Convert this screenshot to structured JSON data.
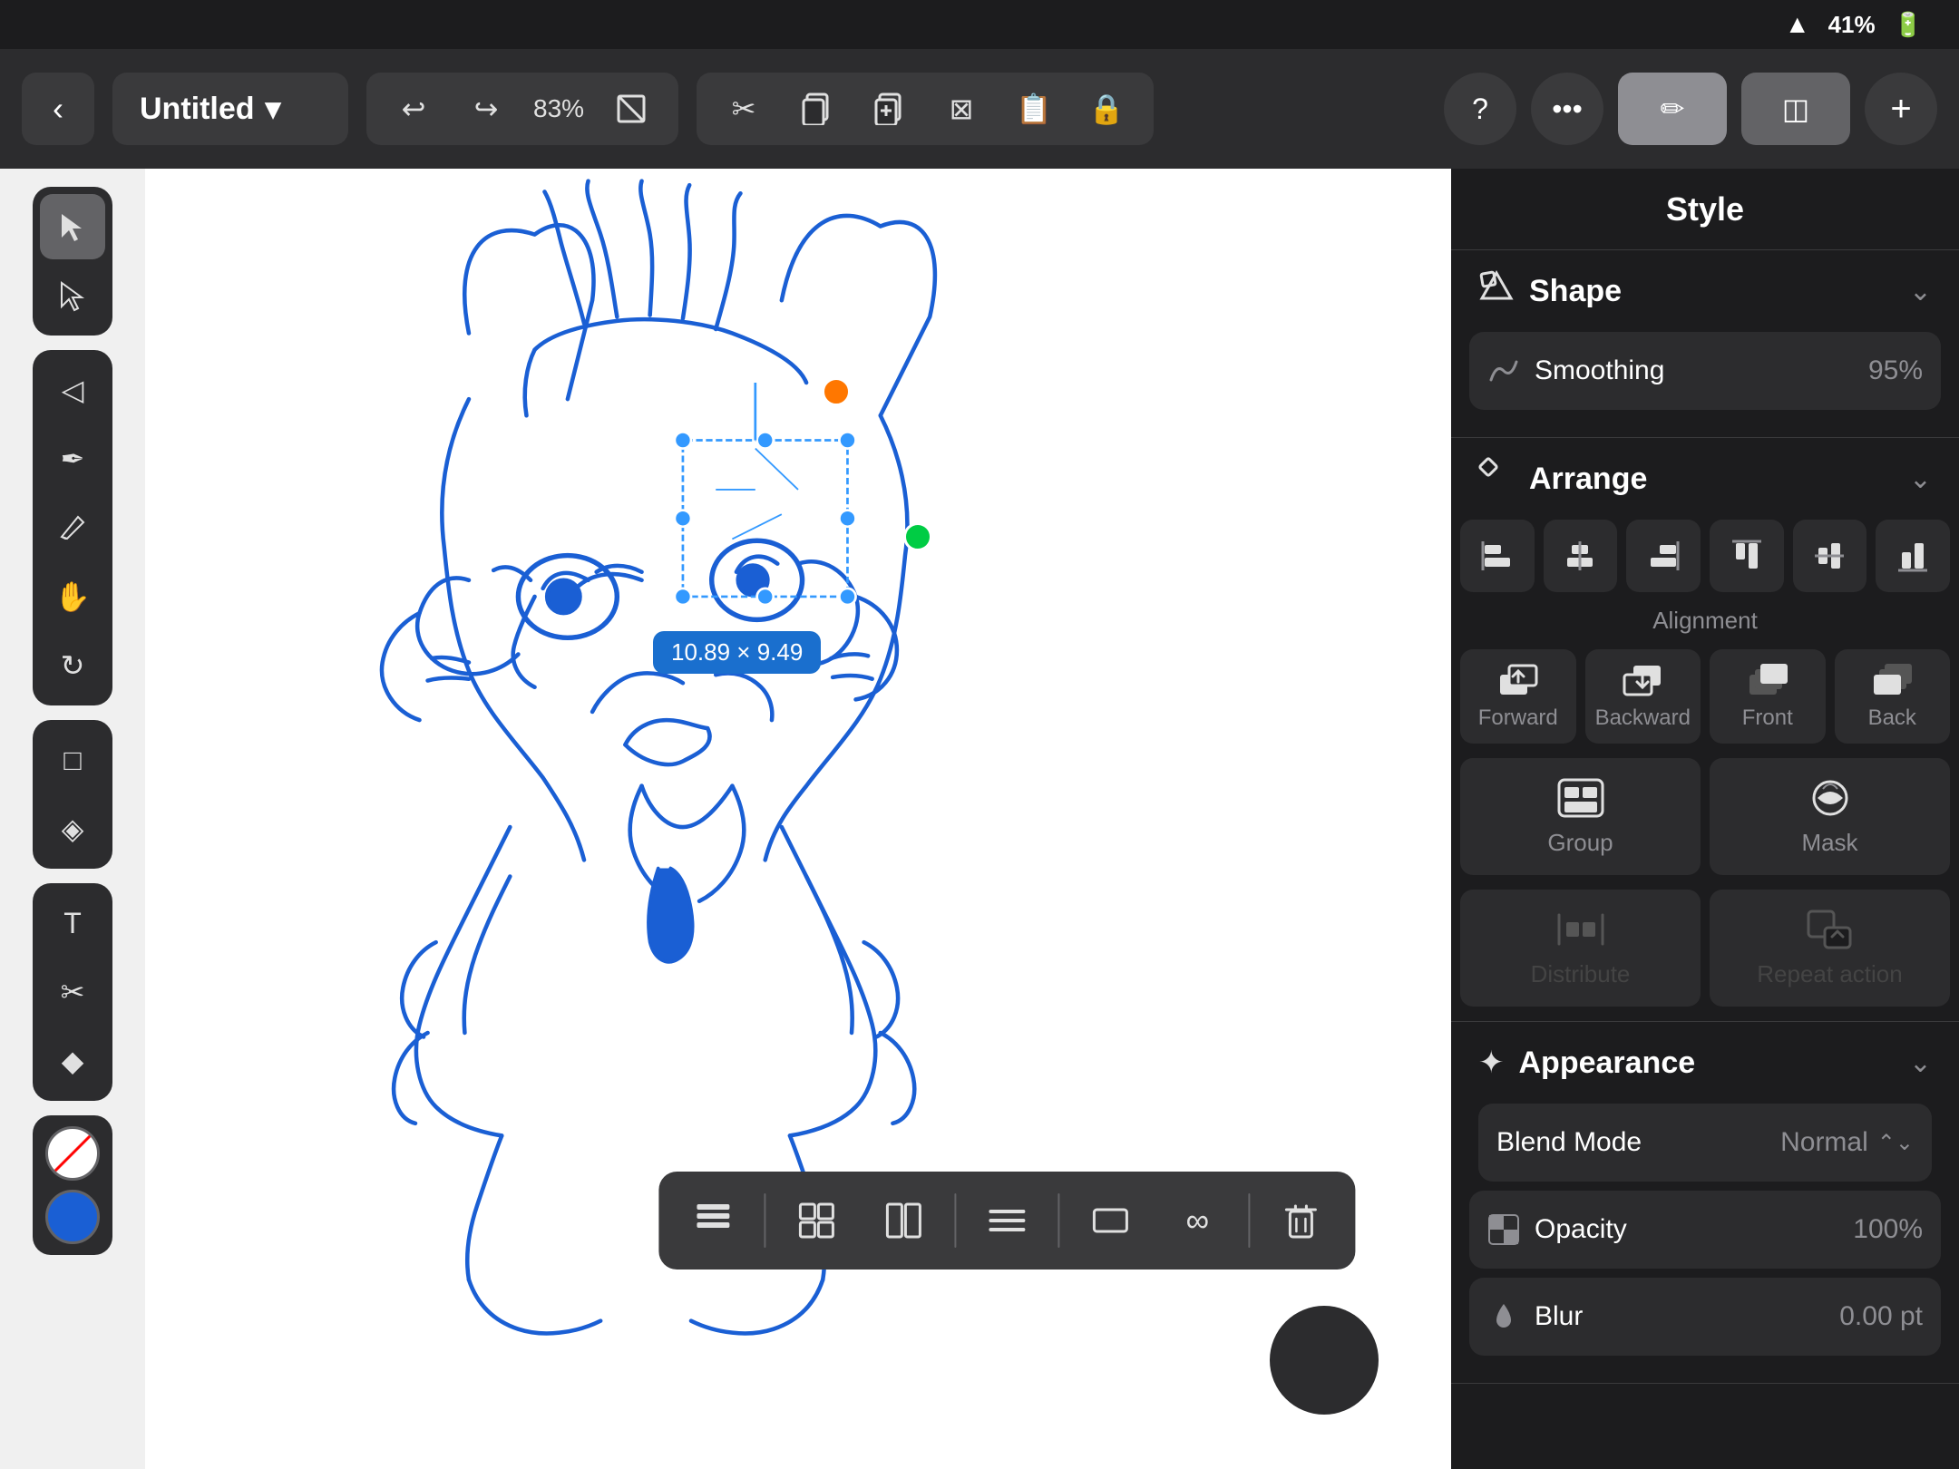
{
  "statusBar": {
    "wifi": "WiFi",
    "batteryPercent": "41%"
  },
  "topToolbar": {
    "backLabel": "‹",
    "docTitle": "Untitled",
    "docDropdown": "▾",
    "undoLabel": "↩",
    "redoLabel": "↪",
    "zoomLevel": "83%",
    "cropIcon": "⊞",
    "cutIcon": "✂",
    "copyIcon": "⎘",
    "duplicateIcon": "❐",
    "deleteIcon": "⊠",
    "pasteIcon": "📋",
    "lockIcon": "🔒",
    "helpIcon": "?",
    "moreIcon": "•••",
    "styleTabIcon": "✏",
    "layersTabIcon": "◫",
    "addIcon": "+"
  },
  "leftTools": {
    "selectTool": "▲",
    "directSelectTool": "◁",
    "shapeTool": "◇",
    "penTool": "✒",
    "pencilTool": "△",
    "smudgeTool": "✋",
    "rotateTool": "↻",
    "rectTool": "□",
    "nodeTool": "◈",
    "textTool": "T",
    "scissorsTool": "✂",
    "fillTool": "◆",
    "colorNone": "none",
    "colorBlue": "#1a5fd4"
  },
  "canvas": {
    "sizeLabel": "10.89 × 9.49"
  },
  "floatingToolbar": {
    "layersIcon": "◫",
    "gridIcon": "⊞",
    "splitIcon": "⧉",
    "alignIcon": "≡",
    "frameIcon": "▭",
    "infinityIcon": "∞",
    "deleteIcon": "🗑"
  },
  "rightPanel": {
    "title": "Style",
    "shapeSectionTitle": "Shape",
    "shapeIcon": "⬡",
    "smoothingLabel": "Smoothing",
    "smoothingValue": "95%",
    "chevronIcon": "⌄",
    "arrangeSectionTitle": "Arrange",
    "arrangeIcon": "◇",
    "alignmentLabel": "Alignment",
    "alignmentButtons": [
      {
        "icon": "⊟",
        "label": ""
      },
      {
        "icon": "⊞",
        "label": ""
      },
      {
        "icon": "⊠",
        "label": ""
      },
      {
        "icon": "⊡",
        "label": ""
      },
      {
        "icon": "⊢",
        "label": ""
      },
      {
        "icon": "⊣",
        "label": ""
      }
    ],
    "forwardLabel": "Forward",
    "backwardLabel": "Backward",
    "frontLabel": "Front",
    "backLabel": "Back",
    "groupLabel": "Group",
    "maskLabel": "Mask",
    "distributeLabel": "Distribute",
    "repeatActionLabel": "Repeat action",
    "appearanceSectionTitle": "Appearance",
    "appearanceIcon": "✦",
    "blendModeLabel": "Blend Mode",
    "blendModeValue": "Normal",
    "opacityLabel": "Opacity",
    "opacityIcon": "⊞",
    "opacityValue": "100%",
    "blurLabel": "Blur",
    "blurIcon": "💧",
    "blurValue": "0.00 pt"
  }
}
